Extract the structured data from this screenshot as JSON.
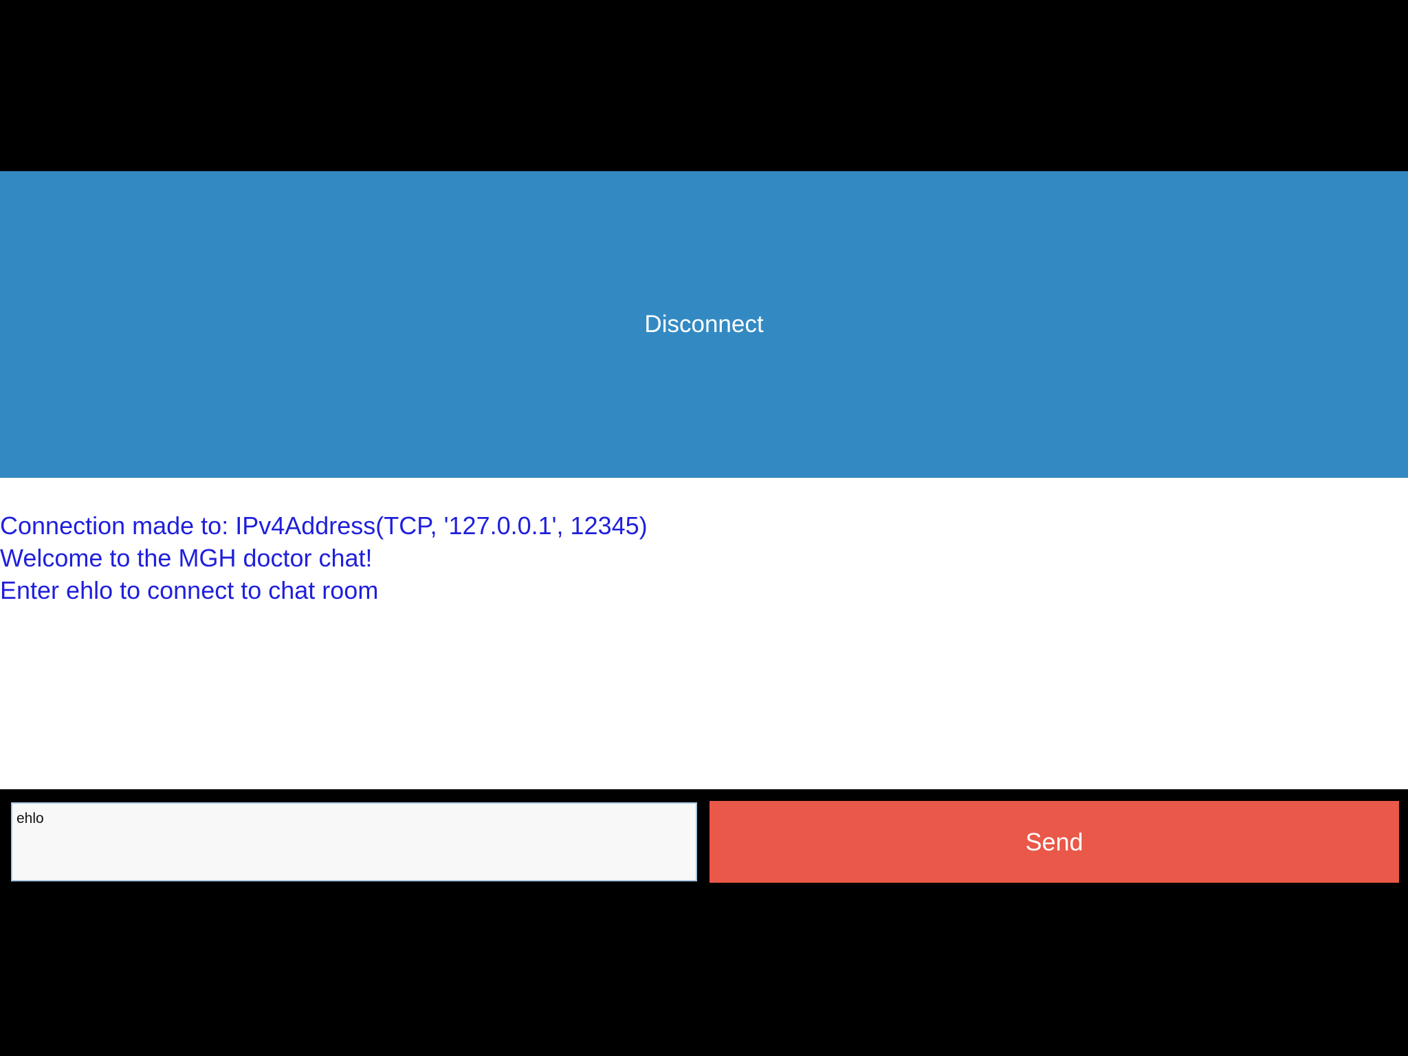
{
  "colors": {
    "background": "#000000",
    "disconnect_button": "#338ac3",
    "send_button": "#e95848",
    "chat_text": "#1f1fdc",
    "chat_background": "#ffffff",
    "input_background": "#f8f8f8"
  },
  "header": {
    "disconnect_label": "Disconnect"
  },
  "chat": {
    "messages": [
      "Connection made to: IPv4Address(TCP, '127.0.0.1', 12345)",
      "Welcome to the MGH doctor chat!",
      "Enter ehlo to connect to chat room"
    ]
  },
  "composer": {
    "input_value": "ehlo",
    "send_label": "Send"
  }
}
